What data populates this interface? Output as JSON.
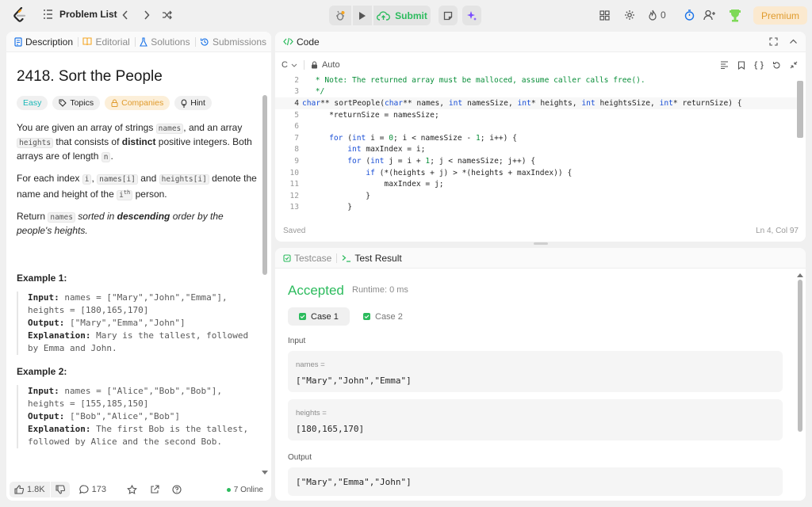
{
  "topbar": {
    "problem_list": "Problem List",
    "submit": "Submit",
    "streak_count": "0",
    "premium": "Premium"
  },
  "colors": {
    "accent_green": "#2cbb5d",
    "premium": "#e09b2d",
    "easy": "#1cb8b8",
    "keyword": "#1a4fd6",
    "comment": "#0a8f3a"
  },
  "left_tabs": [
    "Description",
    "Editorial",
    "Solutions",
    "Submissions"
  ],
  "problem": {
    "title": "2418. Sort the People",
    "badges": {
      "easy": "Easy",
      "topics": "Topics",
      "companies": "Companies",
      "hint": "Hint"
    },
    "p1": {
      "a": "You are given an array of strings ",
      "names": "names",
      "b": ", and an array ",
      "heights": "heights",
      "c": " that consists of ",
      "distinct": "distinct",
      "d": " positive integers. Both arrays are of length ",
      "n": "n",
      "e": "."
    },
    "p2": {
      "a": "For each index ",
      "i": "i",
      "b": ", ",
      "names_i": "names[i]",
      "c": " and ",
      "heights_i": "heights[i]",
      "d": " denote the name and height of the ",
      "ith": "i",
      "th": "th",
      "e": " person."
    },
    "p3": {
      "a": "Return ",
      "names": "names",
      "b": " sorted in ",
      "descending": "descending",
      "c": " order by the people's heights."
    },
    "ex1": {
      "title": "Example 1:",
      "input_label": "Input:",
      "input": " names = [\"Mary\",\"John\",\"Emma\"], heights = [180,165,170]",
      "output_label": "Output:",
      "output": " [\"Mary\",\"Emma\",\"John\"]",
      "explanation_label": "Explanation:",
      "explanation": " Mary is the tallest, followed by Emma and John."
    },
    "ex2": {
      "title": "Example 2:",
      "input_label": "Input:",
      "input": " names = [\"Alice\",\"Bob\",\"Bob\"], heights = [155,185,150]",
      "output_label": "Output:",
      "output": " [\"Bob\",\"Alice\",\"Bob\"]",
      "explanation_label": "Explanation:",
      "explanation": " The first Bob is the tallest, followed by Alice and the second Bob."
    }
  },
  "desc_footer": {
    "likes": "1.8K",
    "comments": "173",
    "online": "7 Online"
  },
  "code": {
    "title": "Code",
    "language": "C",
    "mode": "Auto",
    "saved": "Saved",
    "position": "Ln 4, Col 97",
    "line_numbers": [
      "2",
      "3",
      "4",
      "5",
      "6",
      "7",
      "8",
      "9",
      "10",
      "11",
      "12",
      "13"
    ]
  },
  "result": {
    "tabs": {
      "testcase": "Testcase",
      "test_result": "Test Result"
    },
    "status": "Accepted",
    "runtime": "Runtime: 0 ms",
    "case1": "Case 1",
    "case2": "Case 2",
    "input_label": "Input",
    "names_label": "names =",
    "names_value": "[\"Mary\",\"John\",\"Emma\"]",
    "heights_label": "heights =",
    "heights_value": "[180,165,170]",
    "output_label": "Output",
    "output_value": "[\"Mary\",\"Emma\",\"John\"]"
  }
}
